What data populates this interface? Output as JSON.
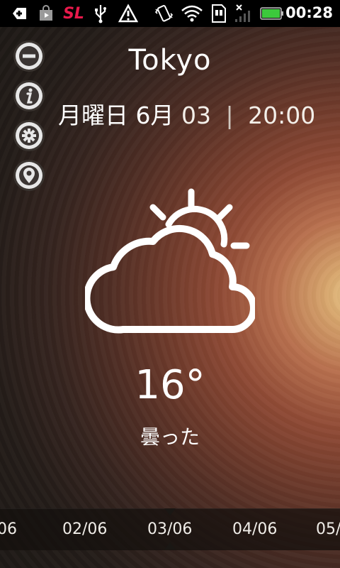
{
  "statusbar": {
    "time": "00:28",
    "sl_label": "SL",
    "icons": [
      "add-icon",
      "store-icon",
      "sl-icon",
      "usb-icon",
      "warning-icon",
      "vibrate-icon",
      "wifi-icon",
      "sim-icon",
      "signal-off-icon",
      "battery-icon"
    ],
    "battery_color": "#3cc93c"
  },
  "side_buttons": [
    "remove-city-icon",
    "info-icon",
    "settings-icon",
    "location-icon"
  ],
  "weather": {
    "city": "Tokyo",
    "day": "月曜日",
    "month": "6月",
    "date": "03",
    "separator": "|",
    "time": "20:00",
    "temperature": "16°",
    "condition": "曇った",
    "icon": "partly-cloudy-icon"
  },
  "date_strip": {
    "items": [
      "06",
      "02/06",
      "03/06",
      "04/06",
      "05/0"
    ],
    "selected": "03/06"
  }
}
